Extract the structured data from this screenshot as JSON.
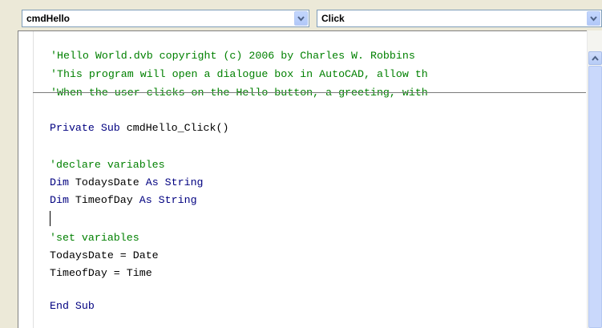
{
  "toolbar": {
    "object_combo": {
      "value": "cmdHello"
    },
    "procedure_combo": {
      "value": "Click"
    }
  },
  "editor": {
    "header_lines": [
      "'Hello World.dvb copyright (c) 2006 by Charles W. Robbins",
      "'This program will open a dialogue box in AutoCAD, allow th",
      "'When the user clicks on the Hello button, a greeting, with"
    ],
    "code": {
      "sub_kw": "Private Sub",
      "sub_name": " cmdHello_Click()",
      "comment_declare": "'declare variables",
      "dim1_kw": "Dim",
      "dim1_var": " TodaysDate ",
      "dim1_as": "As String",
      "dim2_kw": "Dim",
      "dim2_var": " TimeofDay ",
      "dim2_as": "As String",
      "comment_set": "'set variables",
      "assign1": "TodaysDate = Date",
      "assign2": "TimeofDay = Time",
      "end_sub": "End Sub"
    }
  },
  "colors": {
    "comment": "#008000",
    "keyword": "#000080",
    "identifier": "#000000",
    "background": "#ece9d8"
  },
  "icons": [
    "chevron-down-icon",
    "scroll-up-arrow-icon"
  ]
}
